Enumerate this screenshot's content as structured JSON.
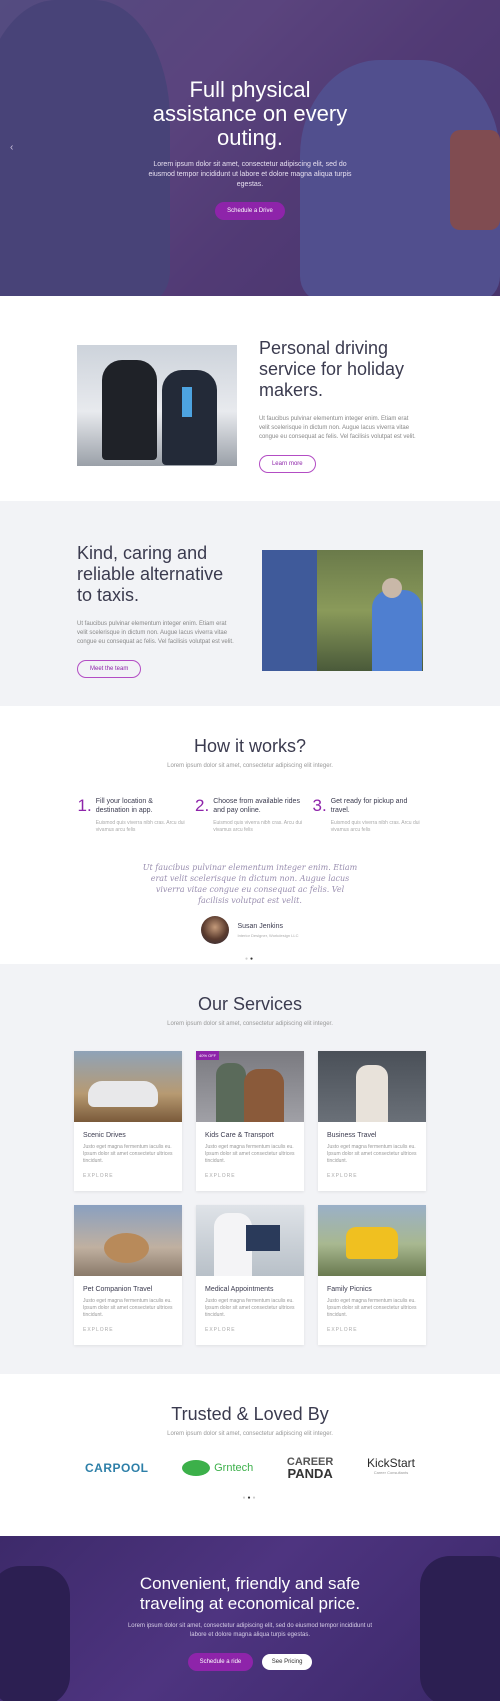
{
  "hero": {
    "title": "Full physical assistance on every outing.",
    "text": "Lorem ipsum dolor sit amet, consectetur adipiscing elit, sed do eiusmod tempor incididunt ut labore et dolore magna aliqua turpis egestas.",
    "button": "Schedule a Drive",
    "prev_arrow": "‹"
  },
  "feature1": {
    "title": "Personal driving service for holiday makers.",
    "text": "Ut faucibus pulvinar elementum integer enim. Etiam erat velit scelerisque in dictum non. Augue lacus viverra vitae congue eu consequat ac felis. Vel facilisis volutpat est velit.",
    "button": "Learn more"
  },
  "feature2": {
    "title": "Kind, caring and reliable alternative to taxis.",
    "text": "Ut faucibus pulvinar elementum integer enim. Etiam erat velit scelerisque in dictum non. Augue lacus viverra vitae congue eu consequat ac felis. Vel facilisis volutpat est velit.",
    "button": "Meet the team"
  },
  "how": {
    "title": "How it works?",
    "subtitle": "Lorem ipsum dolor sit amet, consectetur adipiscing elit integer.",
    "steps": [
      {
        "num": "1.",
        "title": "Fill your location & destination in app.",
        "desc": "Euismod quis viverra nibh cras. Arcu dui vivamus arcu felis"
      },
      {
        "num": "2.",
        "title": "Choose from available rides and pay online.",
        "desc": "Euismod quis viverra nibh cras. Arcu dui vivamus arcu felis"
      },
      {
        "num": "3.",
        "title": "Get ready for pickup and travel.",
        "desc": "Euismod quis viverra nibh cras. Arcu dui vivamus arcu felis"
      }
    ],
    "quote": "Ut faucibus pulvinar elementum integer enim. Etiam erat velit scelerisque in dictum non. Augue lacus viverra vitae congue eu consequat ac felis. Vel facilisis volutpat est velit.",
    "testimonial": {
      "name": "Susan Jenkins",
      "role": "Interior Designer, Workdesign LLC"
    }
  },
  "services": {
    "title": "Our Services",
    "subtitle": "Lorem ipsum dolor sit amet, consectetur adipiscing elit integer.",
    "badge": "40% OFF",
    "items": [
      {
        "title": "Scenic Drives",
        "desc": "Justo eget magna fermentum iaculis eu. Ipsum dolor sit amet consectetur ultrices tincidunt.",
        "link": "EXPLORE"
      },
      {
        "title": "Kids Care & Transport",
        "desc": "Justo eget magna fermentum iaculis eu. Ipsum dolor sit amet consectetur ultrices tincidunt.",
        "link": "EXPLORE"
      },
      {
        "title": "Business Travel",
        "desc": "Justo eget magna fermentum iaculis eu. Ipsum dolor sit amet consectetur ultrices tincidunt.",
        "link": "EXPLORE"
      },
      {
        "title": "Pet Companion Travel",
        "desc": "Justo eget magna fermentum iaculis eu. Ipsum dolor sit amet consectetur ultrices tincidunt.",
        "link": "EXPLORE"
      },
      {
        "title": "Medical Appointments",
        "desc": "Justo eget magna fermentum iaculis eu. Ipsum dolor sit amet consectetur ultrices tincidunt.",
        "link": "EXPLORE"
      },
      {
        "title": "Family Picnics",
        "desc": "Justo eget magna fermentum iaculis eu. Ipsum dolor sit amet consectetur ultrices tincidunt.",
        "link": "EXPLORE"
      }
    ]
  },
  "trusted": {
    "title": "Trusted & Loved By",
    "subtitle": "Lorem ipsum dolor sit amet, consectetur adipiscing elit integer.",
    "logos": {
      "carpool": "CARPOOL",
      "grntech": "Grntech",
      "career_line1": "CAREER",
      "career_line2": "PANDA",
      "kickstart": "KickStart",
      "kickstart_sub": "Career Consultants"
    }
  },
  "cta": {
    "title": "Convenient, friendly and safe traveling at economical price.",
    "text": "Lorem ipsum dolor sit amet, consectetur adipiscing elit, sed do eiusmod tempor incididunt ut labore et dolore magna aliqua turpis egestas.",
    "primary": "Schedule a ride",
    "secondary": "See Pricing"
  },
  "colors": {
    "accent": "#8e24aa",
    "dark": "#3b3b4f",
    "alt_bg": "#f2f3f6"
  }
}
